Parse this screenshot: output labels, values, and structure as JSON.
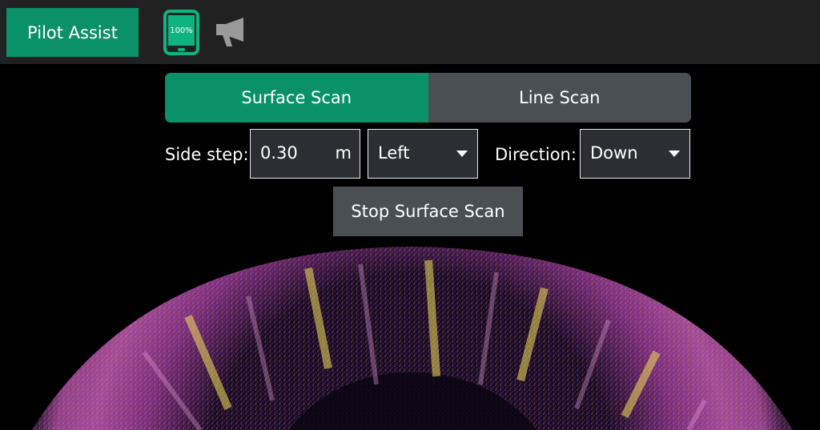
{
  "topbar": {
    "pilot_assist_label": "Pilot Assist",
    "battery_percent": "100%",
    "tablet_icon": "tablet-icon",
    "announce_icon": "megaphone-icon"
  },
  "tabs": [
    {
      "label": "Surface Scan",
      "active": true
    },
    {
      "label": "Line Scan",
      "active": false
    }
  ],
  "controls": {
    "side_step_label": "Side step:",
    "side_step_value": "0.30",
    "side_step_unit": "m",
    "side_value": "Left",
    "direction_label": "Direction:",
    "direction_value": "Down",
    "stop_button_label": "Stop Surface Scan"
  },
  "colors": {
    "accent": "#0a9168",
    "button_gray": "#4a4f54",
    "topbar_bg": "#212121",
    "field_bg": "#2b2f33"
  }
}
